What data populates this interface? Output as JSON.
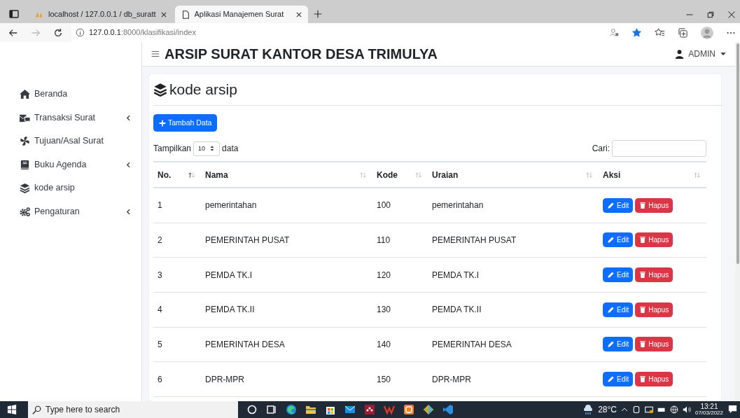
{
  "browser": {
    "tabs": [
      {
        "title": "localhost / 127.0.0.1 / db_suratt",
        "selected": false
      },
      {
        "title": "Aplikasi Manajemen Surat",
        "selected": true
      }
    ],
    "address": {
      "host": "127.0.0.1",
      "path": ":8000/klasifikasi/index"
    }
  },
  "header": {
    "title": "ARSIP SURAT KANTOR DESA TRIMULYA",
    "user": "ADMIN"
  },
  "sidebar": {
    "items": [
      {
        "label": "Beranda",
        "has_submenu": false
      },
      {
        "label": "Transaksi Surat",
        "has_submenu": true
      },
      {
        "label": "Tujuan/Asal Surat",
        "has_submenu": false
      },
      {
        "label": "Buku Agenda",
        "has_submenu": true
      },
      {
        "label": "kode arsip",
        "has_submenu": false
      },
      {
        "label": "Pengaturan",
        "has_submenu": true
      }
    ]
  },
  "page": {
    "title": "kode arsip",
    "add_button": "Tambah Data",
    "length_before": "Tampilkan",
    "length_value": "10",
    "length_after": "data",
    "search_label": "Cari:"
  },
  "table": {
    "columns": [
      {
        "label": "No.",
        "sorted": true
      },
      {
        "label": "Nama",
        "sorted": false
      },
      {
        "label": "Kode",
        "sorted": false
      },
      {
        "label": "Uraian",
        "sorted": false
      },
      {
        "label": "Aksi",
        "sorted": false
      }
    ],
    "rows": [
      {
        "no": "1",
        "nama": "pemerintahan",
        "kode": "100",
        "uraian": "pemerintahan",
        "edit": "Edit",
        "delete": "Hapus"
      },
      {
        "no": "2",
        "nama": "PEMERINTAH PUSAT",
        "kode": "110",
        "uraian": "PEMERINTAH PUSAT",
        "edit": "Edit",
        "delete": "Hapus"
      },
      {
        "no": "3",
        "nama": "PEMDA TK.I",
        "kode": "120",
        "uraian": "PEMDA TK.I",
        "edit": "Edit",
        "delete": "Hapus"
      },
      {
        "no": "4",
        "nama": "PEMDA TK.II",
        "kode": "130",
        "uraian": "PEMDA TK.II",
        "edit": "Edit",
        "delete": "Hapus"
      },
      {
        "no": "5",
        "nama": "PEMERINTAH DESA",
        "kode": "140",
        "uraian": "PEMERINTAH DESA",
        "edit": "Edit",
        "delete": "Hapus"
      },
      {
        "no": "6",
        "nama": "DPR-MPR",
        "kode": "150",
        "uraian": "DPR-MPR",
        "edit": "Edit",
        "delete": "Hapus"
      }
    ]
  },
  "taskbar": {
    "search_placeholder": "Type here to search",
    "weather": "28°C",
    "time": "13:21",
    "date": "07/03/2022"
  }
}
